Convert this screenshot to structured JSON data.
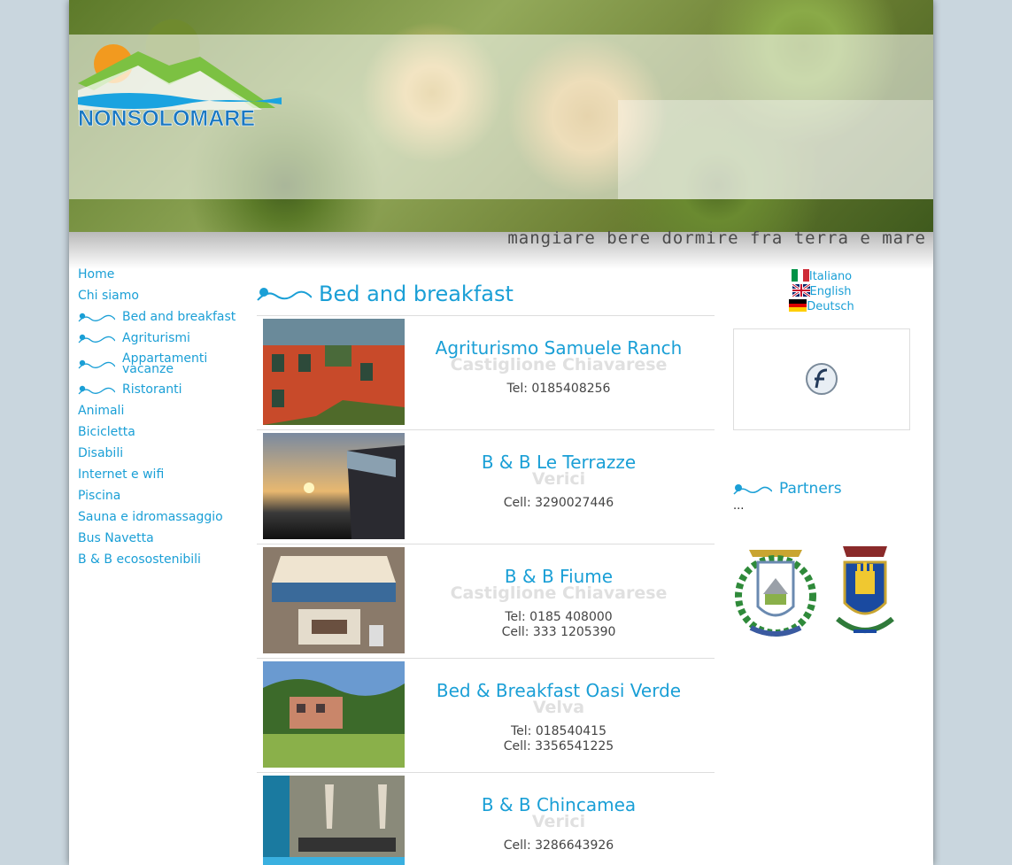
{
  "header": {
    "brand": "NONSOLOMARE",
    "tagline": "mangiare bere dormire fra terra e mare"
  },
  "menu": {
    "items": [
      {
        "label": "Home"
      },
      {
        "label": "Chi siamo"
      },
      {
        "label": "Bed and breakfast"
      },
      {
        "label": "Agriturismi"
      },
      {
        "label": "Appartamenti vacanze"
      },
      {
        "label": "Ristoranti"
      },
      {
        "label": "Animali"
      },
      {
        "label": "Bicicletta"
      },
      {
        "label": "Disabili"
      },
      {
        "label": "Internet e wifi"
      },
      {
        "label": "Piscina"
      },
      {
        "label": "Sauna e idromassaggio"
      },
      {
        "label": "Bus Navetta"
      },
      {
        "label": "B & B ecosostenibili"
      }
    ]
  },
  "main": {
    "title": "Bed and breakfast",
    "listings": [
      {
        "name": "Agriturismo Samuele Ranch",
        "place": "Castiglione Chiavarese",
        "phone1": "Tel: 0185408256",
        "phone2": ""
      },
      {
        "name": "B & B Le Terrazze",
        "place": "Verici",
        "phone1": "Cell: 3290027446",
        "phone2": ""
      },
      {
        "name": "B & B Fiume",
        "place": "Castiglione Chiavarese",
        "phone1": "Tel: 0185 408000",
        "phone2": "Cell: 333 1205390"
      },
      {
        "name": "Bed & Breakfast Oasi Verde",
        "place": "Velva",
        "phone1": "Tel: 018540415",
        "phone2": "Cell: 3356541225"
      },
      {
        "name": "B & B Chincamea",
        "place": "Verici",
        "phone1": "Cell: 3286643926",
        "phone2": ""
      }
    ]
  },
  "right": {
    "languages": [
      {
        "label": "Italiano",
        "flag": "flag-italy-icon"
      },
      {
        "label": "English",
        "flag": "flag-uk-icon"
      },
      {
        "label": "Deutsch",
        "flag": "flag-germany-icon"
      }
    ],
    "partners_title": "Partners",
    "partners_text": "..."
  },
  "colors": {
    "accent": "#1a9fd6",
    "text": "#444444"
  }
}
